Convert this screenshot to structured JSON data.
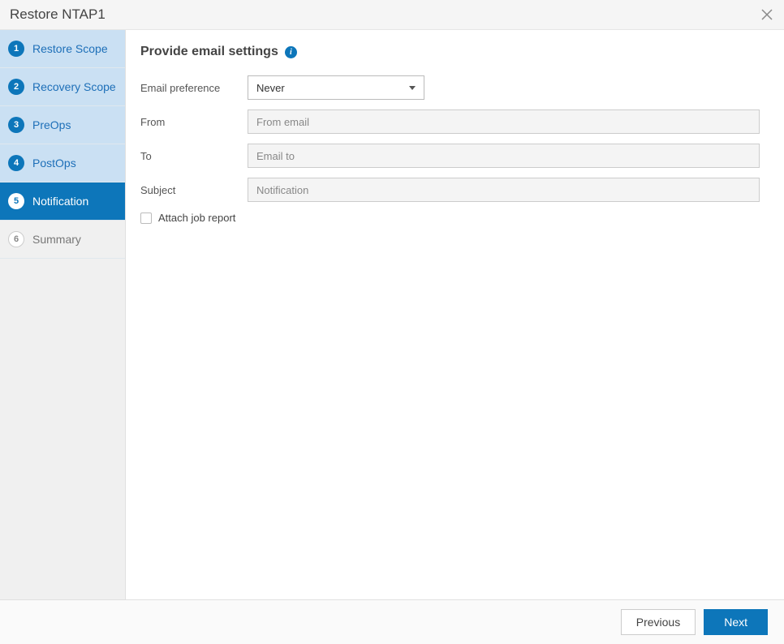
{
  "header": {
    "title": "Restore NTAP1"
  },
  "sidebar": {
    "steps": [
      {
        "num": "1",
        "label": "Restore Scope"
      },
      {
        "num": "2",
        "label": "Recovery Scope"
      },
      {
        "num": "3",
        "label": "PreOps"
      },
      {
        "num": "4",
        "label": "PostOps"
      },
      {
        "num": "5",
        "label": "Notification"
      },
      {
        "num": "6",
        "label": "Summary"
      }
    ]
  },
  "main": {
    "title": "Provide email settings",
    "email_preference_label": "Email preference",
    "email_preference_value": "Never",
    "from_label": "From",
    "from_placeholder": "From email",
    "to_label": "To",
    "to_placeholder": "Email to",
    "subject_label": "Subject",
    "subject_placeholder": "Notification",
    "attach_label": "Attach job report"
  },
  "footer": {
    "previous": "Previous",
    "next": "Next"
  }
}
